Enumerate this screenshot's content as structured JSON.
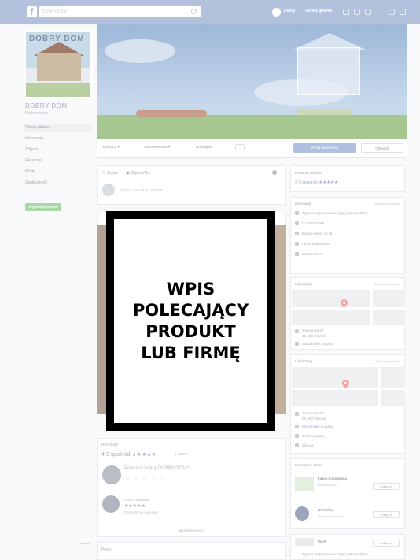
{
  "topbar": {
    "logo": "f",
    "search_placeholder": "DOBRY DOM",
    "user_link": "Dobry",
    "home_link": "Strona główna"
  },
  "page": {
    "name": "DOBRY DOM",
    "category": "Budownictwo",
    "profile_logo": "DOBRY DOM"
  },
  "nav": {
    "items": [
      "Strona główna",
      "Informacje",
      "Zdjęcia",
      "Recenzje",
      "Posty",
      "Społeczność"
    ],
    "promote": "Wypromuj stronę"
  },
  "actionbar": {
    "like": "Lubię to! ▾",
    "follow": "Obserwowanie ▾",
    "share": "Udostępnij",
    "more": "···",
    "message": "Wyślij wiadomość",
    "visit": "Odwiedź"
  },
  "composer": {
    "tab_post": "✎ Status",
    "tab_photo": "▣ Zdjęcie/film",
    "placeholder": "Napisz coś na tej stronie..."
  },
  "overlay": {
    "lines": [
      "WPIS",
      "POLECAJĄCY",
      "PRODUKT",
      "LUB FIRMĘ"
    ]
  },
  "reviews": {
    "title": "Recenzje",
    "score": "4,9 spośród ★★★★★",
    "of": "5 opinii",
    "question": "Polecisz stronę DOBRY DOM?",
    "empty_stars": "☆ ☆ ☆ ☆ ☆",
    "reviewer_name": "Anna Kowalska",
    "reviewer_stars": "★★★★★",
    "review_text": "Dobra firma, polecam",
    "more": "Wyświetl więcej",
    "posts_label": "Posty"
  },
  "right": {
    "community_title": "Firma w Otwocku",
    "community_score": "4,9 spośród ★★★★★",
    "about_title": "Informacje",
    "about_link": "Zobacz wszystkie",
    "about_lines": [
      "Typowo odpowiada w ciągu jednego dnia",
      "DOBRY DOM",
      "Buduje domy od lat",
      "Firma budowlana",
      "Otwarte teraz"
    ],
    "map_title": "Lokalizacja",
    "map_link": "Zobacz wszystkie",
    "address1": "Jesionowa 37",
    "address2": "05-400 Otwock",
    "directions": "Wskazówki dojazdu",
    "address3": "Jesionowa 37",
    "address4": "05-400 Otwock",
    "directions2": "Wskazówki dojazdu",
    "hours": "Godziny pracy",
    "photos": "Zdjęcia",
    "related_title": "Powiązane strony",
    "related": [
      {
        "name": "Firma budowlana",
        "sub": "Budownictwo",
        "like": "Lubię to!"
      },
      {
        "name": "Dom Plus",
        "sub": "Usługi budowlane",
        "like": "Lubię to!"
      }
    ],
    "bottom_line": "Typowo odpowiada w ciągu jednego dnia",
    "bottom_name": "WAS",
    "bottom_like": "Lubię to!"
  },
  "colors": {
    "topbar": "#b3c1dc",
    "accent": "#9ab0d7",
    "promote": "#a8d8a6",
    "overlay_border": "#000000"
  }
}
